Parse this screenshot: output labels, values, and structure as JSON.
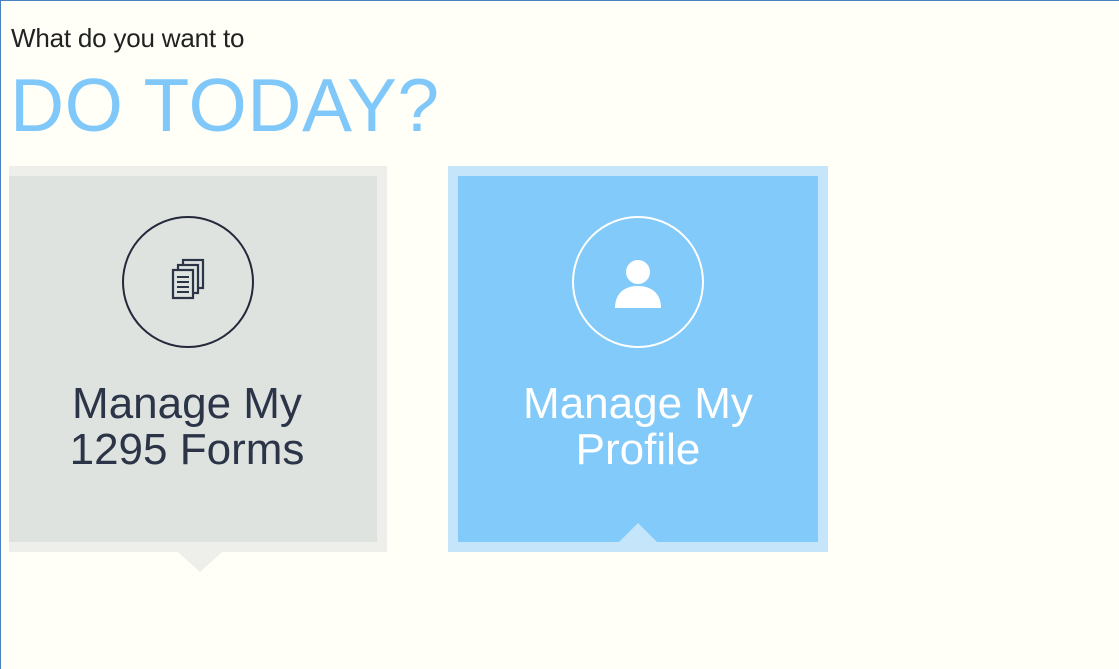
{
  "header": {
    "subtitle": "What do you want to",
    "headline": "DO TODAY?"
  },
  "tiles": [
    {
      "line1": "Manage My",
      "line2": "1295 Forms",
      "icon": "documents-icon",
      "state": "default"
    },
    {
      "line1": "Manage My",
      "line2": "Profile",
      "icon": "user-icon",
      "state": "active"
    }
  ],
  "colors": {
    "accent": "#80c8fa",
    "tile_default_bg": "#dfe3df",
    "tile_active_bg": "#82caf9",
    "page_bg": "#fffff8"
  }
}
